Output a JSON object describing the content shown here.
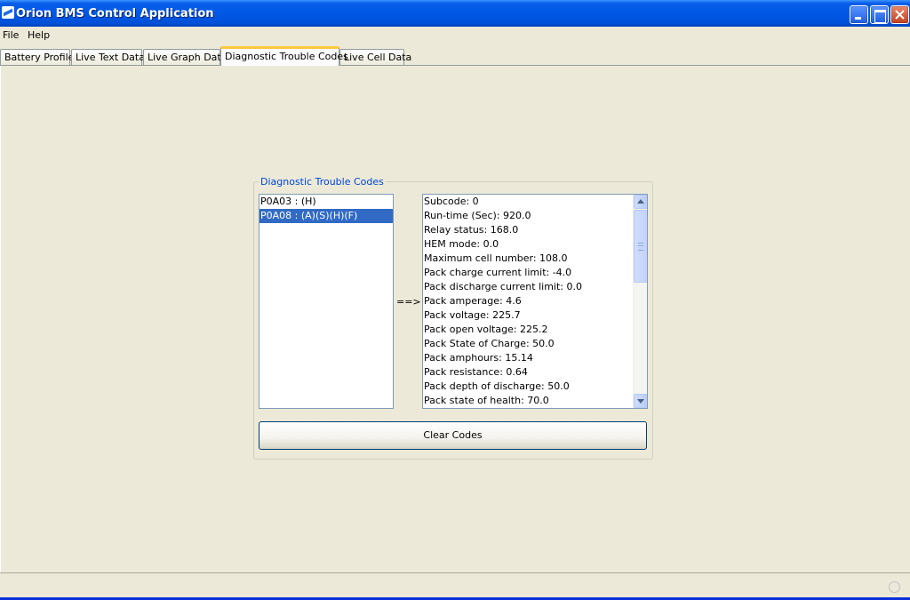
{
  "window": {
    "title": "Orion BMS Control Application"
  },
  "menu": {
    "items": [
      "File",
      "Help"
    ]
  },
  "tabs": [
    {
      "label": "Battery Profile",
      "active": false
    },
    {
      "label": "Live Text Data",
      "active": false
    },
    {
      "label": "Live Graph Data",
      "active": false
    },
    {
      "label": "Diagnostic Trouble Codes",
      "active": true
    },
    {
      "label": "Live Cell Data",
      "active": false
    }
  ],
  "dtc_panel": {
    "title": "Diagnostic Trouble Codes",
    "codes": [
      {
        "label": "P0A03 : (H)",
        "selected": false
      },
      {
        "label": "P0A08 : (A)(S)(H)(F)",
        "selected": true
      }
    ],
    "arrow": "==>",
    "details": [
      "Subcode: 0",
      "Run-time (Sec): 920.0",
      "Relay status: 168.0",
      "HEM mode: 0.0",
      "Maximum cell number: 108.0",
      "Pack charge current limit: -4.0",
      "Pack discharge current limit: 0.0",
      "Pack amperage: 4.6",
      "Pack voltage: 225.7",
      "Pack open voltage: 225.2",
      "Pack State of Charge: 50.0",
      "Pack amphours: 15.14",
      "Pack resistance: 0.64",
      "Pack depth of discharge: 50.0",
      "Pack state of health: 70.0"
    ],
    "clear_button": "Clear Codes"
  },
  "colors": {
    "titlebar": "#0058e6",
    "selection": "#316ac5",
    "group_title": "#0046d5",
    "window_bg": "#ece9d8"
  }
}
